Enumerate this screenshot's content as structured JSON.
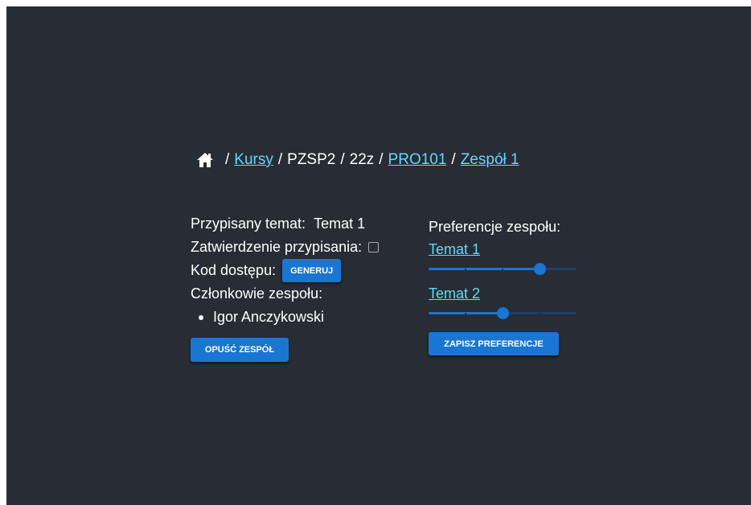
{
  "breadcrumb": {
    "home_icon": "home-icon",
    "separator": "/",
    "items": [
      {
        "label": "Kursy",
        "link": true
      },
      {
        "label": "PZSP2",
        "link": false
      },
      {
        "label": "22z",
        "link": false
      },
      {
        "label": "PRO101",
        "link": true
      },
      {
        "label": "Zespół 1",
        "link": true
      }
    ]
  },
  "team": {
    "assigned_topic_label": "Przypisany temat:",
    "assigned_topic_value": "Temat 1",
    "approval_label": "Zatwierdzenie przypisania:",
    "approval_checked": false,
    "access_code_label": "Kod dostępu:",
    "generate_button": "Generuj",
    "members_label": "Członkowie zespołu:",
    "members": [
      "Igor Anczykowski"
    ],
    "leave_button": "Opuść zespół"
  },
  "preferences": {
    "title": "Preferencje zespołu:",
    "topics": [
      {
        "label": "Temat 1",
        "value": 0.75
      },
      {
        "label": "Temat 2",
        "value": 0.5
      }
    ],
    "save_button": "Zapisz preferencje"
  },
  "colors": {
    "background": "#282c34",
    "link": "#61dafb",
    "button": "#1976d2"
  }
}
